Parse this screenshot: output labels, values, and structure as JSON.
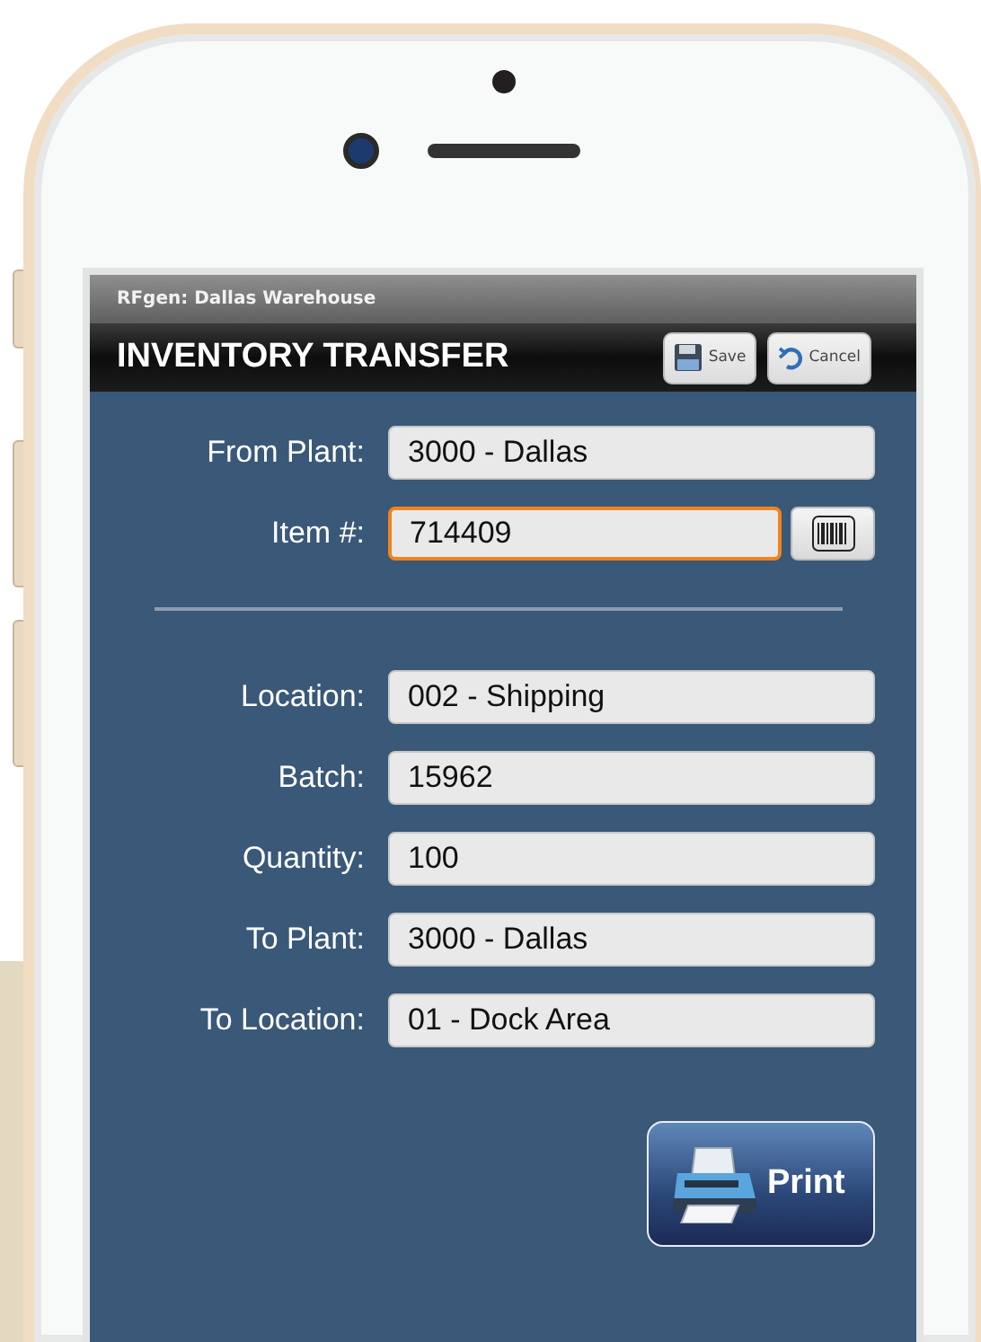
{
  "app_header": {
    "subtitle": "RFgen: Dallas Warehouse",
    "title": "INVENTORY TRANSFER",
    "buttons": [
      {
        "label": "Save",
        "kind": "save"
      },
      {
        "label": "Cancel",
        "kind": "cancel"
      }
    ]
  },
  "form": {
    "fields_top": [
      {
        "label": "From Plant:",
        "value": "3000 - Dallas",
        "focused": false,
        "scan": false
      },
      {
        "label": "Item #:",
        "value": "714409",
        "focused": true,
        "scan": true
      }
    ],
    "fields_bottom": [
      {
        "label": "Location:",
        "value": "002 - Shipping",
        "focused": false,
        "scan": false
      },
      {
        "label": "Batch:",
        "value": "15962",
        "focused": false,
        "scan": false
      },
      {
        "label": "Quantity:",
        "value": "100",
        "focused": false,
        "scan": false
      },
      {
        "label": "To Plant:",
        "value": "3000 - Dallas",
        "focused": false,
        "scan": false
      },
      {
        "label": "To Location:",
        "value": "01 - Dock Area",
        "focused": false,
        "scan": false
      }
    ]
  },
  "print_button": {
    "label": "Print"
  }
}
